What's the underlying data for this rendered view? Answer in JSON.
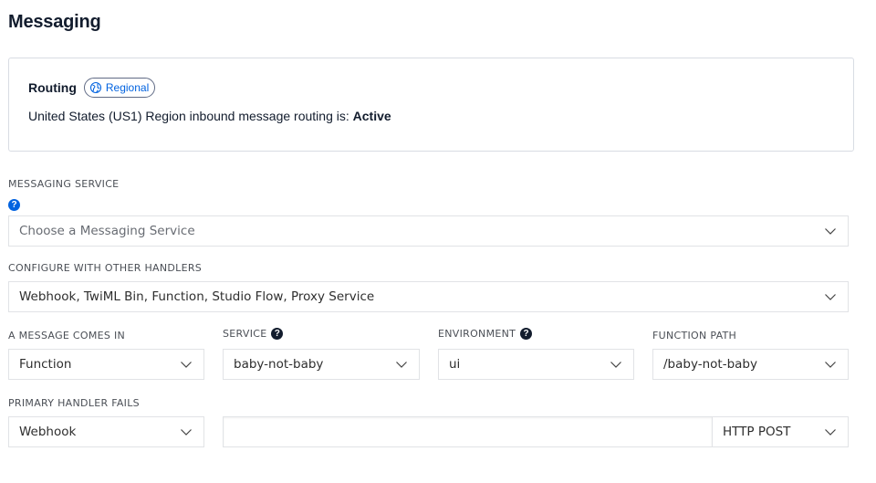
{
  "page": {
    "title": "Messaging"
  },
  "routing_card": {
    "label": "Routing",
    "badge": {
      "icon": "globe-icon",
      "text": "Regional",
      "color": "#0263e0"
    },
    "status_prefix": "United States (US1) Region inbound message routing is: ",
    "status_value": "Active"
  },
  "messaging_service": {
    "label": "MESSAGING SERVICE",
    "help_icon": "question-circle-icon",
    "placeholder": "Choose a Messaging Service"
  },
  "other_handlers": {
    "label": "CONFIGURE WITH OTHER HANDLERS",
    "value": "Webhook, TwiML Bin, Function, Studio Flow, Proxy Service"
  },
  "message_comes_in": {
    "label": "A MESSAGE COMES IN",
    "value": "Function"
  },
  "service": {
    "label": "SERVICE",
    "help_icon": "question-circle-icon",
    "value": "baby-not-baby"
  },
  "environment": {
    "label": "ENVIRONMENT",
    "help_icon": "question-circle-icon",
    "value": "ui"
  },
  "function_path": {
    "label": "FUNCTION PATH",
    "value": "/baby-not-baby"
  },
  "primary_handler_fails": {
    "label": "PRIMARY HANDLER FAILS",
    "handler_value": "Webhook",
    "url_value": "",
    "method_value": "HTTP POST"
  },
  "icons": {
    "chevron": "chevron-down-icon",
    "help_glyph": "?"
  }
}
